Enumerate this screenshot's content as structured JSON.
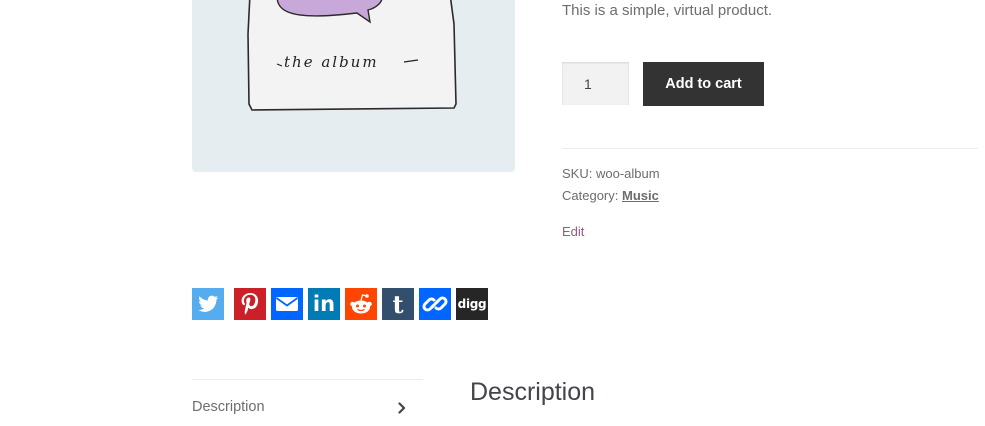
{
  "product": {
    "image_alt_text": "the album",
    "short_description": "This is a simple, virtual product.",
    "quantity_value": "1",
    "add_to_cart_label": "Add to cart",
    "sku_label": "SKU:",
    "sku_value": "woo-album",
    "category_label": "Category:",
    "category_value": "Music",
    "edit_label": "Edit"
  },
  "share": {
    "buttons": [
      {
        "name": "twitter",
        "icon": "twitter-bird-icon",
        "color": "#55acee"
      },
      {
        "name": "pinterest",
        "icon": "pinterest-icon",
        "color": "#cb2027"
      },
      {
        "name": "email",
        "icon": "envelope-icon",
        "color": "#0166ff"
      },
      {
        "name": "linkedin",
        "icon": "linkedin-icon",
        "color": "#007bb5"
      },
      {
        "name": "reddit",
        "icon": "reddit-alien-icon",
        "color": "#ff4500"
      },
      {
        "name": "tumblr",
        "icon": "tumblr-icon",
        "color": "#32506d"
      },
      {
        "name": "copy-link",
        "icon": "chain-link-icon",
        "color": "#0166ff"
      },
      {
        "name": "digg",
        "icon": "digg-icon",
        "color": "#262626"
      }
    ],
    "linkedin_text": "in",
    "tumblr_text": "t",
    "digg_text": "digg"
  },
  "tabs": {
    "items": [
      {
        "label": "Description",
        "active": true
      }
    ]
  },
  "description_panel": {
    "heading": "Description"
  },
  "colors": {
    "button_dark": "#333333",
    "link_purple": "#96588a",
    "image_bg": "#e6edf0"
  }
}
